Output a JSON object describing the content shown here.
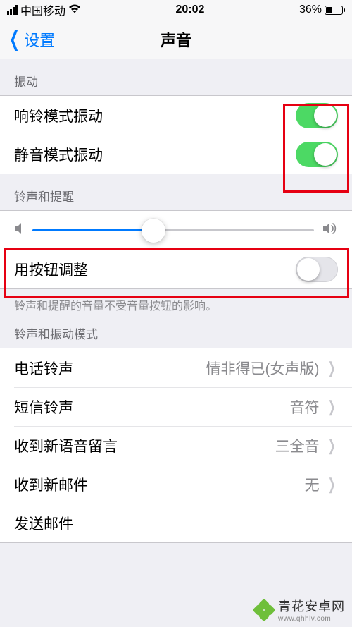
{
  "status": {
    "carrier": "中国移动",
    "time": "20:02",
    "battery_pct": "36%",
    "battery_level": 36
  },
  "nav": {
    "back_label": "设置",
    "title": "声音"
  },
  "sections": {
    "vibrate_header": "振动",
    "ring_vibrate": {
      "label": "响铃模式振动",
      "on": true
    },
    "silent_vibrate": {
      "label": "静音模式振动",
      "on": true
    },
    "ringer_header": "铃声和提醒",
    "volume_pct": 43,
    "change_with_buttons": {
      "label": "用按钮调整",
      "on": false
    },
    "ringer_footer": "铃声和提醒的音量不受音量按钮的影响。",
    "pattern_header": "铃声和振动模式",
    "rows": [
      {
        "label": "电话铃声",
        "value": "情非得已(女声版)"
      },
      {
        "label": "短信铃声",
        "value": "音符"
      },
      {
        "label": "收到新语音留言",
        "value": "三全音"
      },
      {
        "label": "收到新邮件",
        "value": "无"
      },
      {
        "label": "发送邮件",
        "value": ""
      }
    ]
  },
  "watermark": {
    "title": "青花安卓网",
    "url": "www.qhhlv.com"
  }
}
